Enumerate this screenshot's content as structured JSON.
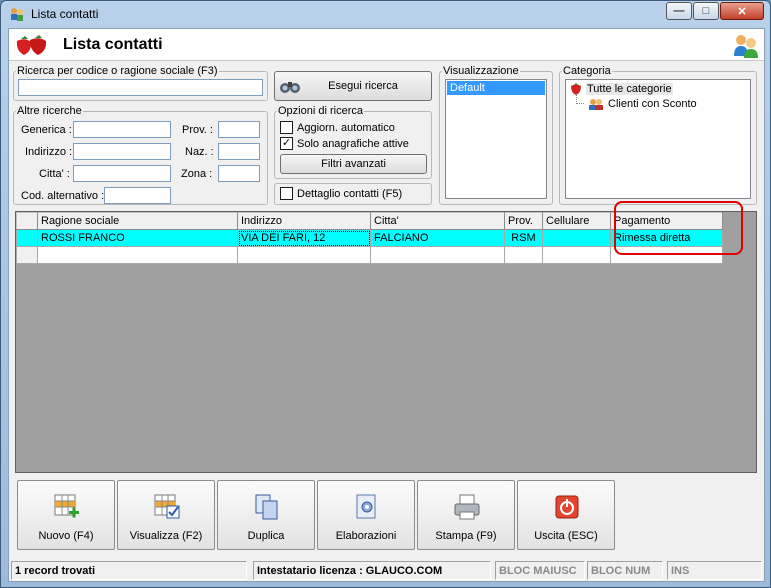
{
  "window": {
    "title": "Lista contatti"
  },
  "header": {
    "title": "Lista contatti"
  },
  "search": {
    "legend": "Ricerca per codice o ragione sociale (F3)",
    "value": "",
    "button": "Esegui ricerca"
  },
  "other": {
    "legend": "Altre ricerche",
    "generica": "Generica :",
    "indirizzo": "Indirizzo :",
    "citta": "Citta' :",
    "cod_alt": "Cod. alternativo :",
    "prov": "Prov. :",
    "naz": "Naz. :",
    "zona": "Zona :"
  },
  "options": {
    "legend": "Opzioni di ricerca",
    "auto_update": {
      "label": "Aggiorn. automatico",
      "checked": false
    },
    "active_only": {
      "label": "Solo anagrafiche attive",
      "checked": true
    },
    "advanced": "Filtri avanzati"
  },
  "detail": {
    "label": "Dettaglio contatti (F5)",
    "checked": false
  },
  "view": {
    "legend": "Visualizzazione",
    "items": [
      "Default"
    ],
    "selected": "Default"
  },
  "category": {
    "legend": "Categoria",
    "root": "Tutte le categorie",
    "children": [
      "Clienti con Sconto"
    ]
  },
  "grid": {
    "columns": [
      "Ragione sociale",
      "Indirizzo",
      "Citta'",
      "Prov.",
      "Cellulare",
      "Pagamento"
    ],
    "rows": [
      [
        "ROSSI FRANCO",
        "VIA DEI FARI, 12",
        "FALCIANO",
        "RSM",
        "",
        "Rimessa diretta"
      ],
      [
        "",
        "",
        "",
        "",
        "",
        ""
      ]
    ]
  },
  "buttons": {
    "nuovo": "Nuovo (F4)",
    "visualizza": "Visualizza (F2)",
    "duplica": "Duplica",
    "elaborazioni": "Elaborazioni",
    "stampa": "Stampa (F9)",
    "uscita": "Uscita (ESC)"
  },
  "status": {
    "records": "1 record trovati",
    "license": "Intestatario licenza : GLAUCO.COM",
    "caps": "BLOC MAIUSC",
    "num": "BLOC NUM",
    "ins": "INS"
  },
  "colors": {
    "selected_row": "#00ffff",
    "highlight_box": "#e00000"
  }
}
